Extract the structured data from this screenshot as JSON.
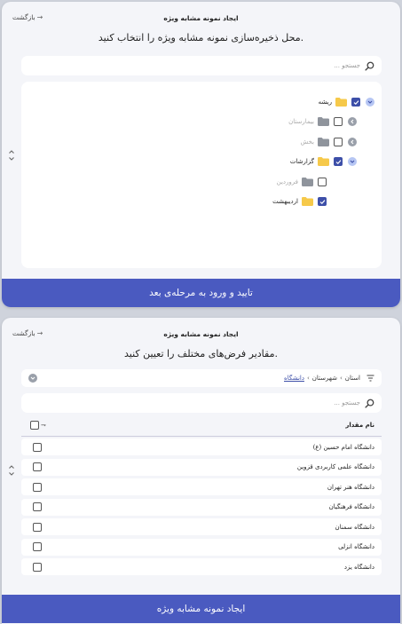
{
  "panel1": {
    "title": "ایجاد نمونه مشابه ویژه",
    "back_label": "بازگشت",
    "subtitle": "محل ذخیره‌سازی نمونه مشابه ویژه را انتخاب کنید.",
    "search_placeholder": "جستجو ...",
    "tree": [
      {
        "label": "ریشه",
        "checked": true,
        "expanded": true,
        "muted": false,
        "folder_color": "#f6c94a"
      },
      {
        "label": "بیمارستان",
        "checked": false,
        "expanded": false,
        "muted": true,
        "folder_color": "#8f949c"
      },
      {
        "label": "بخش",
        "checked": false,
        "expanded": false,
        "muted": true,
        "folder_color": "#8f949c"
      },
      {
        "label": "گزارشات",
        "checked": true,
        "expanded": true,
        "muted": false,
        "folder_color": "#f6c94a"
      },
      {
        "label": "فروردین",
        "checked": false,
        "expanded": null,
        "muted": true,
        "folder_color": "#8f949c"
      },
      {
        "label": "اردیبهشت",
        "checked": true,
        "expanded": null,
        "muted": false,
        "folder_color": "#f6c94a"
      }
    ],
    "confirm_button": "تایید و ورود به مرحله‌ی بعد"
  },
  "panel2": {
    "title": "ایجاد نمونه مشابه ویژه",
    "back_label": "بازگشت",
    "subtitle": "مقادیر فرض‌های مختلف را تعیین کنید.",
    "breadcrumb": {
      "items": [
        "استان",
        "شهرستان",
        "دانشگاه"
      ],
      "separator": "›"
    },
    "search_placeholder": "جستجو ...",
    "column_header": "نام مقدار",
    "rows": [
      "دانشگاه امام حسین (ع)",
      "دانشگاه علمی کاربردی قزوین",
      "دانشگاه هنر تهران",
      "دانشگاه فرهنگیان",
      "دانشگاه سمنان",
      "دانشگاه انزلی",
      "دانشگاه یزد"
    ],
    "create_button": "ایجاد نمونه مشابه ویژه"
  },
  "colors": {
    "accent": "#4a5ac0",
    "checkbox_on": "#3d4fa8",
    "folder_yellow": "#f6c94a",
    "folder_gray": "#8f949c",
    "chevron_blue": "#b6c6f3"
  },
  "icons": {
    "back": "arrow-right-icon",
    "search": "search-icon",
    "expand": "chevron-icon",
    "folder": "folder-icon",
    "filter": "filter-icon",
    "sort": "sort-icon",
    "side": "up-down-arrows-icon"
  }
}
